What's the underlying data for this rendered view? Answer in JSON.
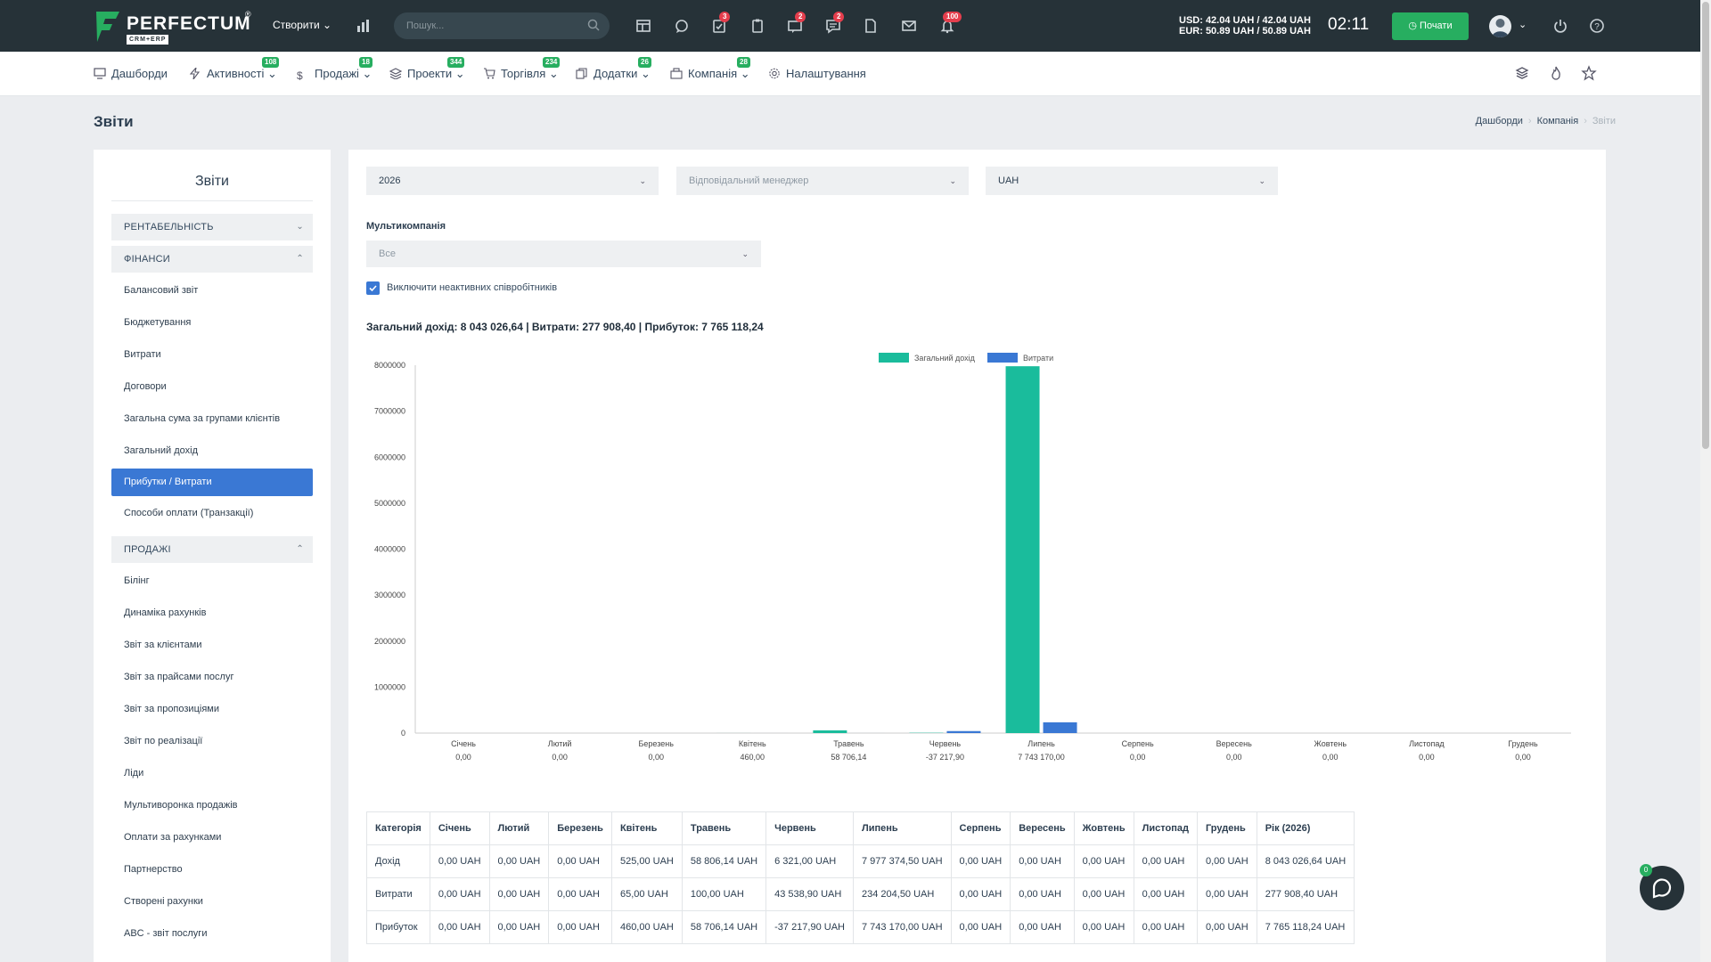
{
  "topbar": {
    "logo_text": "PERFECTUM",
    "logo_reg": "®",
    "logo_sub": "CRM+ERP",
    "create_label": "Створити",
    "search_placeholder": "Пошук...",
    "badges": {
      "tasks": "3",
      "messages": "2",
      "chat": "2",
      "notifications": "100"
    },
    "currency_usd": "USD: 42.04 UAH / 42.04 UAH",
    "currency_eur": "EUR: 50.89 UAH / 50.89 UAH",
    "clock": "02:11",
    "start_label": "Почати"
  },
  "nav": {
    "items": [
      {
        "label": "Дашборди",
        "icon": "monitor-icon",
        "badge": ""
      },
      {
        "label": "Активності",
        "icon": "bolt-icon",
        "badge": "108"
      },
      {
        "label": "Продажі",
        "icon": "dollar-icon",
        "badge": "18"
      },
      {
        "label": "Проекти",
        "icon": "layers-icon",
        "badge": "344"
      },
      {
        "label": "Торгівля",
        "icon": "cart-icon",
        "badge": "234"
      },
      {
        "label": "Додатки",
        "icon": "copy-icon",
        "badge": "26"
      },
      {
        "label": "Компанія",
        "icon": "building-icon",
        "badge": "28"
      },
      {
        "label": "Налаштування",
        "icon": "gear-icon",
        "badge": ""
      }
    ]
  },
  "page": {
    "title": "Звіти",
    "breadcrumb": [
      "Дашборди",
      "Компанія",
      "Звіти"
    ]
  },
  "side": {
    "title": "Звіти",
    "groups": {
      "g1": "РЕНТАБЕЛЬНІСТЬ",
      "g2": "ФІНАНСИ",
      "g3": "ПРОДАЖІ"
    },
    "finance_links": [
      "Балансовий звіт",
      "Бюджетування",
      "Витрати",
      "Договори",
      "Загальна сума за групами клієнтів",
      "Загальний дохід",
      "Прибутки / Витрати",
      "Способи оплати (Транзакції)"
    ],
    "sales_links": [
      "Білінг",
      "Динаміка рахунків",
      "Звіт за клієнтами",
      "Звіт за прайсами послуг",
      "Звіт за пропозиціями",
      "Звіт по реалізації",
      "Ліди",
      "Мультиворонка продажів",
      "Оплати за рахунками",
      "Партнерство",
      "Створені рахунки",
      "ABC - звіт послуги"
    ]
  },
  "filters": {
    "year": "2026",
    "manager_placeholder": "Відповідальний менеджер",
    "currency": "UAH",
    "multicompany_label": "Мультикомпанія",
    "multicompany_value": "Все",
    "exclude_inactive": "Виключити неактивних співробітників"
  },
  "summary": "Загальний дохід: 8 043 026,64 | Витрати: 277 908,40 | Прибуток: 7 765 118,24",
  "chart_data": {
    "type": "bar",
    "categories": [
      "Січень",
      "Лютий",
      "Березень",
      "Квітень",
      "Травень",
      "Червень",
      "Липень",
      "Серпень",
      "Вересень",
      "Жовтень",
      "Листопад",
      "Грудень"
    ],
    "category_sublabels": [
      "0,00",
      "0,00",
      "0,00",
      "460,00",
      "58 706,14",
      "-37 217,90",
      "7 743 170,00",
      "0,00",
      "0,00",
      "0,00",
      "0,00",
      "0,00"
    ],
    "series": [
      {
        "name": "Загальний дохід",
        "color": "#1abc9c",
        "values": [
          0,
          0,
          0,
          525,
          58806.14,
          6321,
          7977374.5,
          0,
          0,
          0,
          0,
          0
        ]
      },
      {
        "name": "Витрати",
        "color": "#3a78d4",
        "values": [
          0,
          0,
          0,
          65,
          100,
          43538.9,
          234204.5,
          0,
          0,
          0,
          0,
          0
        ]
      }
    ],
    "yticks": [
      "0",
      "1000000",
      "2000000",
      "3000000",
      "4000000",
      "5000000",
      "6000000",
      "7000000",
      "8000000"
    ],
    "ylim": [
      0,
      8000000
    ],
    "legend": "top-center"
  },
  "table": {
    "headers": [
      "Категорія",
      "Січень",
      "Лютий",
      "Березень",
      "Квітень",
      "Травень",
      "Червень",
      "Липень",
      "Серпень",
      "Вересень",
      "Жовтень",
      "Листопад",
      "Грудень",
      "Рік (2026)"
    ],
    "rows": [
      [
        "Дохід",
        "0,00 UAH",
        "0,00 UAH",
        "0,00 UAH",
        "525,00 UAH",
        "58 806,14 UAH",
        "6 321,00 UAH",
        "7 977 374,50 UAH",
        "0,00 UAH",
        "0,00 UAH",
        "0,00 UAH",
        "0,00 UAH",
        "0,00 UAH",
        "8 043 026,64 UAH"
      ],
      [
        "Витрати",
        "0,00 UAH",
        "0,00 UAH",
        "0,00 UAH",
        "65,00 UAH",
        "100,00 UAH",
        "43 538,90 UAH",
        "234 204,50 UAH",
        "0,00 UAH",
        "0,00 UAH",
        "0,00 UAH",
        "0,00 UAH",
        "0,00 UAH",
        "277 908,40 UAH"
      ],
      [
        "Прибуток",
        "0,00 UAH",
        "0,00 UAH",
        "0,00 UAH",
        "460,00 UAH",
        "58 706,14 UAH",
        "-37 217,90 UAH",
        "7 743 170,00 UAH",
        "0,00 UAH",
        "0,00 UAH",
        "0,00 UAH",
        "0,00 UAH",
        "0,00 UAH",
        "7 765 118,24 UAH"
      ]
    ]
  },
  "chat": {
    "badge": "0"
  }
}
